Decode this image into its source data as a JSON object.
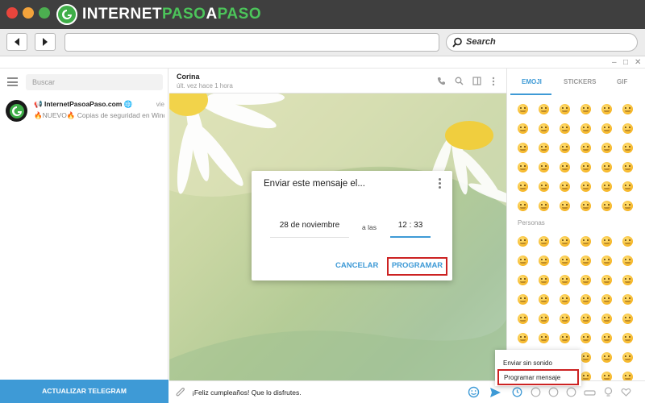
{
  "brand": {
    "prefix": "INTERNET",
    "highlight": "PASO",
    "a": "A",
    "suffix": "PASO"
  },
  "browser": {
    "search_placeholder": "Search"
  },
  "sidebar": {
    "search_placeholder": "Buscar",
    "chat": {
      "name": "InternetPasoaPaso.com",
      "time": "vie",
      "preview": "🔥NUEVO🔥 Copias de seguridad en Windo..."
    },
    "update_button": "ACTUALIZAR TELEGRAM"
  },
  "chat": {
    "title": "Corina",
    "status": "últ. vez hace 1 hora",
    "message_draft": "¡Feliz cumpleaños! Que lo disfrutes."
  },
  "dialog": {
    "title": "Enviar este mensaje el...",
    "date": "28 de noviembre",
    "at_label": "a las",
    "time": "12 : 33",
    "cancel": "CANCELAR",
    "program": "PROGRAMAR"
  },
  "emoji_panel": {
    "tabs": [
      "EMOJI",
      "STICKERS",
      "GIF"
    ],
    "category": "Personas"
  },
  "send_menu": {
    "silent": "Enviar sin sonido",
    "schedule": "Programar mensaje"
  },
  "colors": {
    "accent": "#3e9ad6",
    "highlight_border": "#cc2222",
    "brand_green": "#4cc45a"
  }
}
